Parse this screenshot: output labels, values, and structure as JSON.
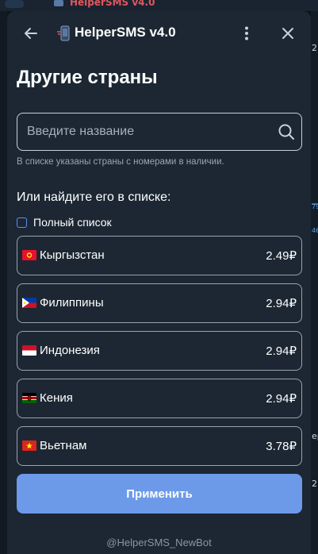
{
  "header": {
    "title": "HelperSMS v4.0",
    "back_icon": "arrow-left-icon",
    "menu_icon": "more-vertical-icon",
    "close_icon": "close-icon"
  },
  "page": {
    "title": "Другие страны"
  },
  "search": {
    "placeholder": "Введите название",
    "value": "",
    "hint": "В списке указаны страны с номерами в наличии."
  },
  "list_section": {
    "title": "Или найдите его в списке:",
    "full_list_label": "Полный список",
    "full_list_checked": false
  },
  "countries": [
    {
      "name": "Кыргызстан",
      "price": "2.49₽",
      "flag": "kg"
    },
    {
      "name": "Филиппины",
      "price": "2.94₽",
      "flag": "ph"
    },
    {
      "name": "Индонезия",
      "price": "2.94₽",
      "flag": "id"
    },
    {
      "name": "Кения",
      "price": "2.94₽",
      "flag": "ke"
    },
    {
      "name": "Вьетнам",
      "price": "3.78₽",
      "flag": "vn"
    }
  ],
  "apply_button": {
    "label": "Применить"
  },
  "footer": {
    "text": "@HelperSMS_NewBot"
  },
  "background": {
    "top_title": "HelperSMS v4.0",
    "right_texts": [
      "2",
      "79",
      "46",
      "ep",
      "2"
    ]
  },
  "colors": {
    "modal_bg": "#1c2733",
    "accent": "#6d9ae8",
    "border": "#9aa3ad",
    "text": "#ffffff",
    "muted": "#9aa5b1"
  }
}
